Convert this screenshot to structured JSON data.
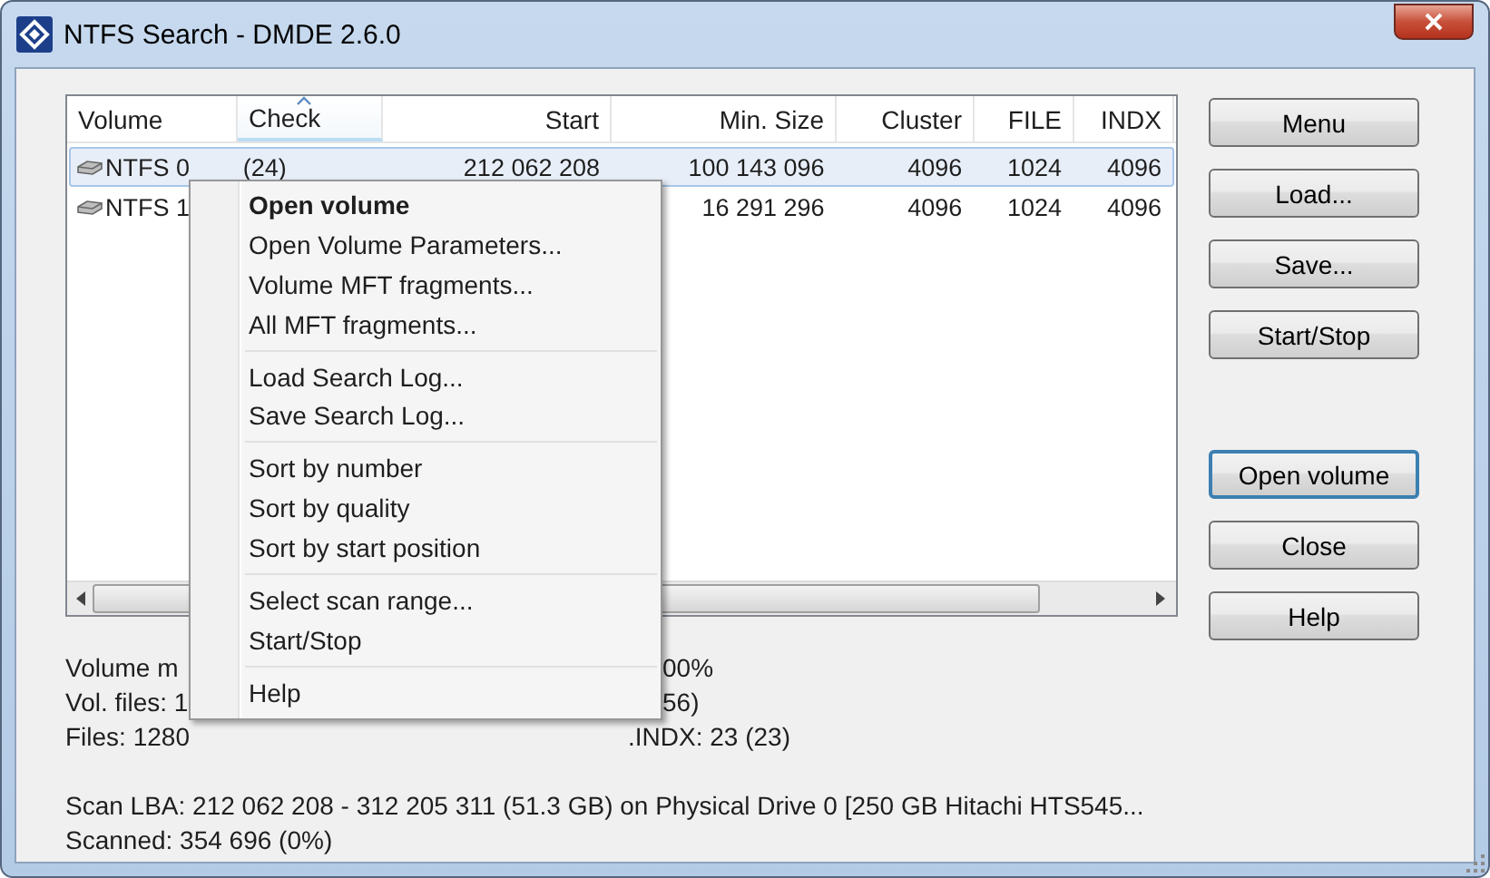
{
  "window": {
    "title": "NTFS Search - DMDE 2.6.0"
  },
  "table": {
    "columns": [
      {
        "label": "Volume",
        "sorted": false
      },
      {
        "label": "Check",
        "sorted": true
      },
      {
        "label": "Start",
        "sorted": false
      },
      {
        "label": "Min. Size",
        "sorted": false
      },
      {
        "label": "Cluster",
        "sorted": false
      },
      {
        "label": "FILE",
        "sorted": false
      },
      {
        "label": "INDX",
        "sorted": false
      }
    ],
    "rows": [
      {
        "selected": true,
        "cells": [
          "NTFS 0",
          "(24)",
          "212 062 208",
          "100 143 096",
          "4096",
          "1024",
          "4096"
        ]
      },
      {
        "selected": false,
        "cells": [
          "NTFS 1",
          "",
          "",
          "16 291 296",
          "4096",
          "1024",
          "4096"
        ]
      }
    ]
  },
  "buttons": [
    {
      "label": "Menu",
      "default": false
    },
    {
      "label": "Load...",
      "default": false
    },
    {
      "label": "Save...",
      "default": false
    },
    {
      "label": "Start/Stop",
      "default": false
    },
    {
      "label": "Open volume",
      "default": true
    },
    {
      "label": "Close",
      "default": false
    },
    {
      "label": "Help",
      "default": false
    }
  ],
  "status_lines": [
    [
      "Volume m",
      "00%"
    ],
    [
      "Vol. files: 1",
      "56)"
    ],
    [
      "Files: 1280",
      ".INDX: 23 (23)"
    ]
  ],
  "scan_lines": [
    "Scan LBA: 212 062 208 - 312 205 311 (51.3 GB) on Physical Drive 0 [250 GB Hitachi HTS545...",
    "Scanned: 354 696 (0%)"
  ],
  "context_menu": {
    "items": [
      {
        "kind": "item",
        "label": "Open volume",
        "default": true
      },
      {
        "kind": "item",
        "label": "Open Volume Parameters...",
        "default": false
      },
      {
        "kind": "item",
        "label": "Volume MFT fragments...",
        "default": false
      },
      {
        "kind": "item",
        "label": "All MFT fragments...",
        "default": false
      },
      {
        "kind": "separator"
      },
      {
        "kind": "item",
        "label": "Load Search Log...",
        "default": false
      },
      {
        "kind": "item",
        "label": "Save Search Log...",
        "default": false
      },
      {
        "kind": "separator"
      },
      {
        "kind": "item",
        "label": "Sort by number",
        "default": false
      },
      {
        "kind": "item",
        "label": "Sort by quality",
        "default": false
      },
      {
        "kind": "item",
        "label": "Sort by start position",
        "default": false
      },
      {
        "kind": "separator"
      },
      {
        "kind": "item",
        "label": "Select scan range...",
        "default": false
      },
      {
        "kind": "item",
        "label": "Start/Stop",
        "default": false
      },
      {
        "kind": "separator"
      },
      {
        "kind": "item",
        "label": "Help",
        "default": false
      }
    ]
  }
}
